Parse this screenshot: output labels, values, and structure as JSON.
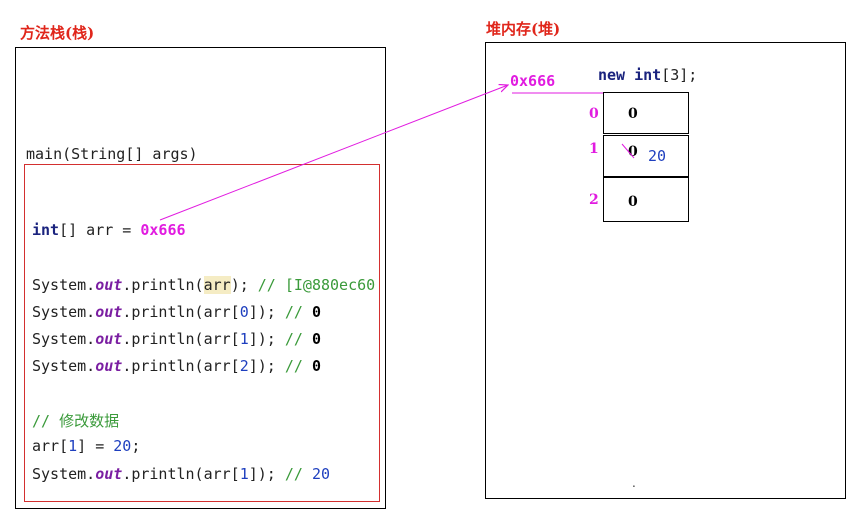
{
  "stack": {
    "title": "方法栈(栈)",
    "frame_label": "main(String[] args)",
    "decl_type": "int",
    "decl_rest": "[] arr = ",
    "decl_addr": "0x666",
    "lines": [
      {
        "prefix": "System.",
        "field": "out",
        "mid": ".println(",
        "arg": "arr",
        "suffix": "); ",
        "comment": "// ",
        "result": "[I@880ec60"
      },
      {
        "prefix": "System.",
        "field": "out",
        "mid": ".println(arr[",
        "arg": "0",
        "suffix": "]); ",
        "comment": "// ",
        "result": "0"
      },
      {
        "prefix": "System.",
        "field": "out",
        "mid": ".println(arr[",
        "arg": "1",
        "suffix": "]); ",
        "comment": "// ",
        "result": "0"
      },
      {
        "prefix": "System.",
        "field": "out",
        "mid": ".println(arr[",
        "arg": "2",
        "suffix": "]); ",
        "comment": "// ",
        "result": "0"
      }
    ],
    "modify_comment": "// 修改数据",
    "assign_lhs": "arr[",
    "assign_idx": "1",
    "assign_mid": "] = ",
    "assign_val": "20",
    "assign_end": ";",
    "last": {
      "prefix": "System.",
      "field": "out",
      "mid": ".println(arr[",
      "arg": "1",
      "suffix": "]); ",
      "comment": "// ",
      "result": "20"
    }
  },
  "heap": {
    "title": "堆内存(堆)",
    "address": "0x666",
    "new_kw": "new",
    "new_type": "int",
    "new_size": "[3];",
    "cells": [
      {
        "index": "0",
        "value": "0"
      },
      {
        "index": "1",
        "value": "0",
        "new_value": "20"
      },
      {
        "index": "2",
        "value": "0"
      }
    ],
    "dot": "."
  },
  "colors": {
    "title": "#e0261b",
    "address": "#e11be0",
    "frame_border": "#d32f2f",
    "arrow": "#e11be0"
  }
}
